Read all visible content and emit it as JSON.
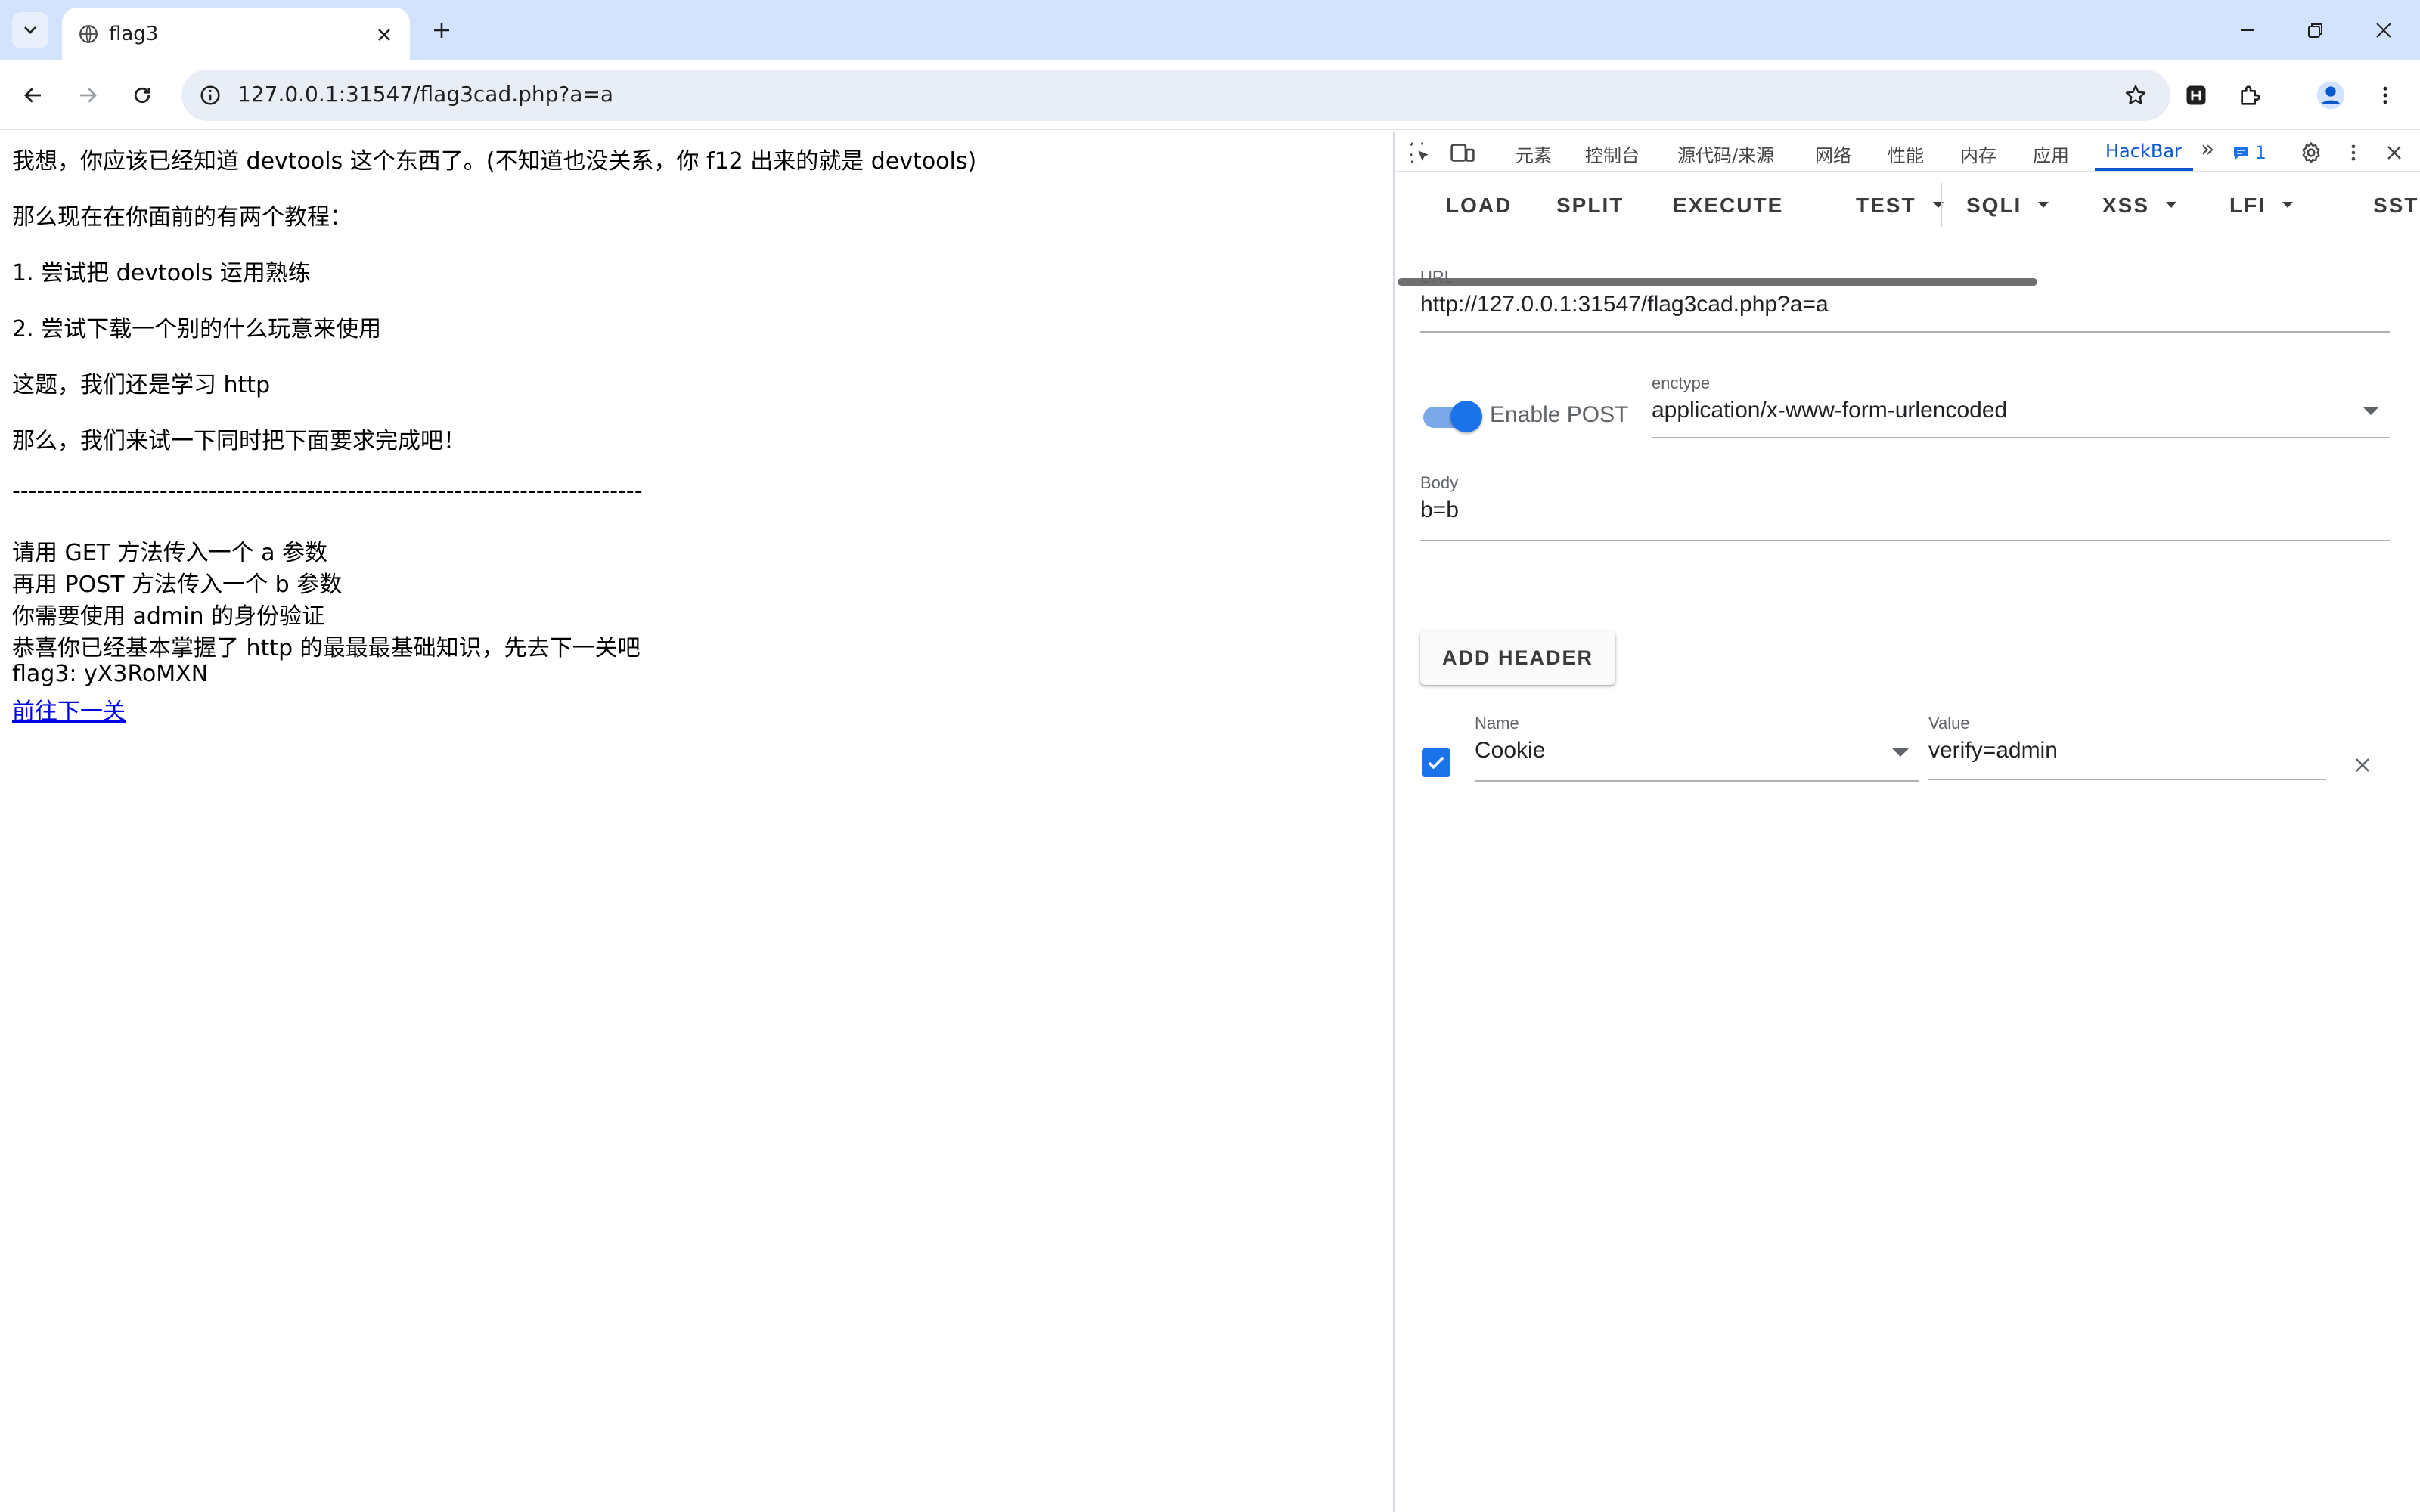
{
  "browser": {
    "tab_title": "flag3",
    "url": "127.0.0.1:31547/flag3cad.php?a=a"
  },
  "page": {
    "lines": [
      "我想，你应该已经知道 devtools 这个东西了。(不知道也没关系，你 f12 出来的就是 devtools)",
      "那么现在在你面前的有两个教程：",
      "1. 尝试把 devtools 运用熟练",
      "2. 尝试下载一个别的什么玩意来使用",
      "这题，我们还是学习 http",
      "那么，我们来试一下同时把下面要求完成吧！",
      "-----------------------------------------------------------------------------",
      "请用 GET 方法传入一个 a 参数",
      "再用 POST 方法传入一个 b 参数",
      "你需要使用 admin 的身份验证",
      "恭喜你已经基本掌握了 http 的最最最基础知识，先去下一关吧",
      "flag3: yX3RoMXN"
    ],
    "next_link": "前往下一关"
  },
  "devtools": {
    "tabs": [
      "元素",
      "控制台",
      "源代码/来源",
      "网络",
      "性能",
      "内存",
      "应用",
      "HackBar"
    ],
    "active_tab": "HackBar",
    "more": "»",
    "issues_count": "1"
  },
  "hackbar": {
    "buttons": [
      "LOAD",
      "SPLIT",
      "EXECUTE",
      "TEST",
      "SQLI",
      "XSS",
      "LFI",
      "SSTI"
    ],
    "url_label": "URL",
    "url_value": "http://127.0.0.1:31547/flag3cad.php?a=a",
    "enable_post_label": "Enable POST",
    "enable_post_on": true,
    "enctype_label": "enctype",
    "enctype_value": "application/x-www-form-urlencoded",
    "body_label": "Body",
    "body_value": "b=b",
    "add_header_label": "ADD HEADER",
    "header": {
      "enabled": true,
      "name_label": "Name",
      "name_value": "Cookie",
      "value_label": "Value",
      "value_value": "verify=admin"
    }
  },
  "colors": {
    "tabstrip": "#d3e3fd",
    "accent": "#1a73e8",
    "link": "#0000ee"
  }
}
